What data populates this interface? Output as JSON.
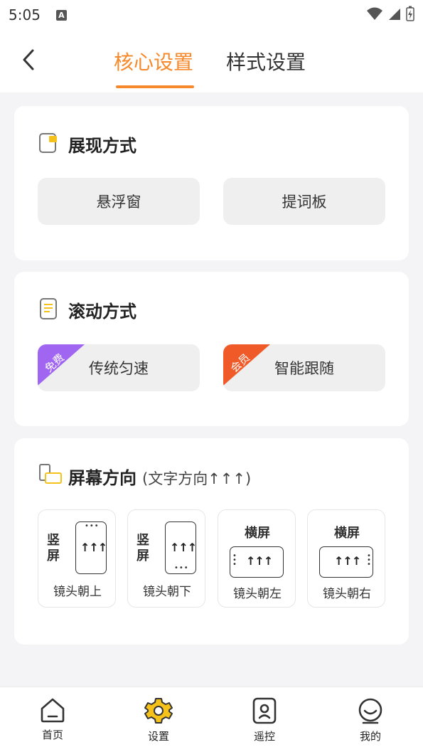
{
  "status_bar": {
    "time": "5:05",
    "notification_letter": "A"
  },
  "header": {
    "tabs": [
      {
        "label": "核心设置",
        "active": true
      },
      {
        "label": "样式设置",
        "active": false
      }
    ]
  },
  "display_mode": {
    "title": "展现方式",
    "options": [
      {
        "label": "悬浮窗"
      },
      {
        "label": "提词板"
      }
    ]
  },
  "scroll_mode": {
    "title": "滚动方式",
    "options": [
      {
        "label": "传统匀速",
        "badge": "免费",
        "badge_color": "#a066f2"
      },
      {
        "label": "智能跟随",
        "badge": "会员",
        "badge_color": "#f05a28"
      }
    ]
  },
  "orientation": {
    "title": "屏幕方向",
    "subtitle": "(文字方向↑↑↑)",
    "arrows": "↑↑↑",
    "options": [
      {
        "type_label": "竖屏",
        "caption": "镜头朝上"
      },
      {
        "type_label": "竖屏",
        "caption": "镜头朝下"
      },
      {
        "type_label": "横屏",
        "caption": "镜头朝左"
      },
      {
        "type_label": "横屏",
        "caption": "镜头朝右"
      }
    ]
  },
  "bottom_nav": {
    "items": [
      {
        "label": "首页"
      },
      {
        "label": "设置",
        "active": true
      },
      {
        "label": "遥控"
      },
      {
        "label": "我的"
      }
    ]
  },
  "colors": {
    "accent": "#f5892b",
    "active_icon": "#f5c21b",
    "background": "#f4f4f6"
  }
}
